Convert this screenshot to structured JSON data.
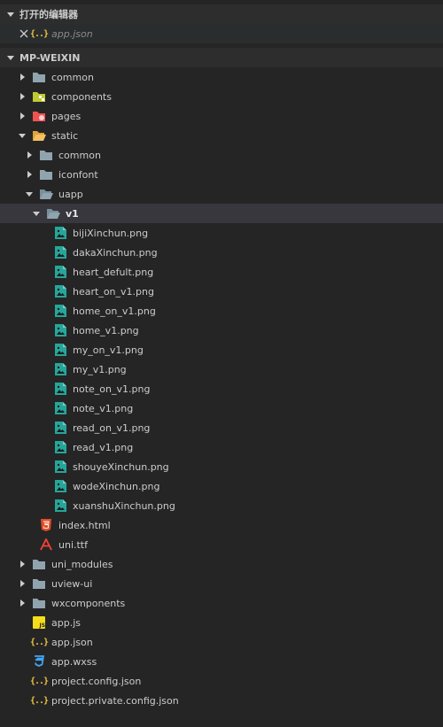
{
  "open_editors": {
    "title": "打开的编辑器",
    "files": [
      {
        "name": "app.json"
      }
    ]
  },
  "explorer": {
    "title": "MP-WEIXIN",
    "root_items": [
      {
        "label": "common"
      },
      {
        "label": "components"
      },
      {
        "label": "pages"
      },
      {
        "label": "static"
      }
    ],
    "static_children": [
      {
        "label": "common"
      },
      {
        "label": "iconfont"
      },
      {
        "label": "uapp"
      }
    ],
    "uapp_children": [
      {
        "label": "v1"
      }
    ],
    "v1_files": [
      {
        "label": "bijiXinchun.png"
      },
      {
        "label": "dakaXinchun.png"
      },
      {
        "label": "heart_defult.png"
      },
      {
        "label": "heart_on_v1.png"
      },
      {
        "label": "home_on_v1.png"
      },
      {
        "label": "home_v1.png"
      },
      {
        "label": "my_on_v1.png"
      },
      {
        "label": "my_v1.png"
      },
      {
        "label": "note_on_v1.png"
      },
      {
        "label": "note_v1.png"
      },
      {
        "label": "read_on_v1.png"
      },
      {
        "label": "read_v1.png"
      },
      {
        "label": "shouyeXinchun.png"
      },
      {
        "label": "wodeXinchun.png"
      },
      {
        "label": "xuanshuXinchun.png"
      }
    ],
    "static_files": [
      {
        "label": "index.html",
        "icon": "html5-icon"
      },
      {
        "label": "uni.ttf",
        "icon": "font-icon"
      }
    ],
    "more_folders": [
      {
        "label": "uni_modules"
      },
      {
        "label": "uview-ui"
      },
      {
        "label": "wxcomponents"
      }
    ],
    "root_files": [
      {
        "label": "app.js",
        "icon": "js-icon"
      },
      {
        "label": "app.json",
        "icon": "json-icon"
      },
      {
        "label": "app.wxss",
        "icon": "css-icon"
      },
      {
        "label": "project.config.json",
        "icon": "json-icon"
      },
      {
        "label": "project.private.config.json",
        "icon": "json-icon"
      }
    ]
  },
  "colors": {
    "background": "#252526",
    "header_bg": "#2d2d2d",
    "selected_row": "#37373d",
    "folder": "#90a4ae",
    "image_icon": "#26a69a",
    "json_icon": "#f0c43f",
    "html_icon": "#e44d26",
    "font_icon": "#f44336",
    "css_icon": "#42a5f5",
    "js_icon": "#f5de19"
  }
}
